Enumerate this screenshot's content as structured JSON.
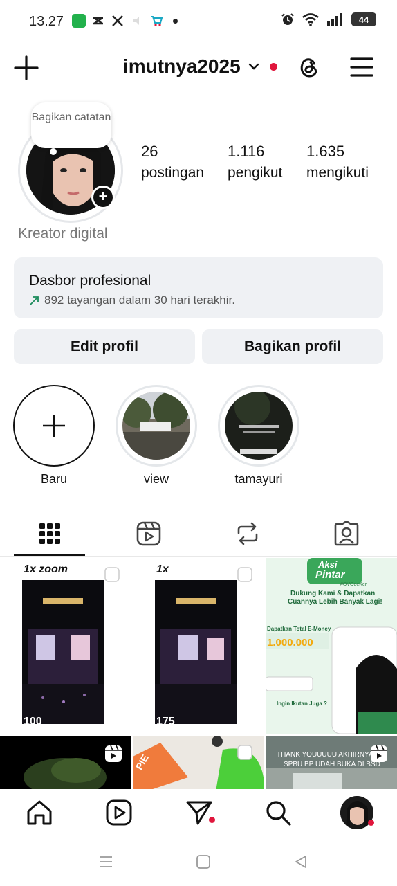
{
  "status_bar": {
    "time": "13.27",
    "battery": "44"
  },
  "header": {
    "username": "imutnya2025"
  },
  "profile": {
    "note": "Bagikan catatan",
    "stats": [
      {
        "value": "26",
        "label": "postingan"
      },
      {
        "value": "1.116",
        "label": "pengikut"
      },
      {
        "value": "1.635",
        "label": "mengikuti"
      }
    ],
    "category": "Kreator digital"
  },
  "dashboard": {
    "title": "Dasbor profesional",
    "subtitle": "892 tayangan dalam 30 hari terakhir."
  },
  "buttons": {
    "edit": "Edit profil",
    "share": "Bagikan profil"
  },
  "highlights": [
    {
      "label": "Baru"
    },
    {
      "label": "view"
    },
    {
      "label": "tamayuri"
    }
  ],
  "tabs": [
    {
      "icon": "grid-icon"
    },
    {
      "icon": "reels-icon"
    },
    {
      "icon": "repost-icon"
    },
    {
      "icon": "tagged-icon"
    }
  ],
  "grid": {
    "posts": [
      {
        "overlay": "1x zoom",
        "count": "100"
      },
      {
        "overlay": "1x",
        "count": "175"
      },
      {
        "title1": "Aksi",
        "title2": "Pintar",
        "tag": "#OVOdeKer",
        "headline": "Dukung Kami & Dapatkan",
        "headline2": "Cuannya Lebih Banyak Lagi!",
        "amount": "1.000.000",
        "prompt": "Ingin Ikutan Juga ?",
        "label": "Dapatkan Total E-Money"
      },
      {},
      {
        "brand": "PIE"
      },
      {
        "caption": "THANK YOUUUUU AKHIRNYA",
        "caption2": "SPBU BP UDAH BUKA DI BSD"
      }
    ]
  },
  "colors": {
    "accent_red": "#e0163c",
    "button_bg": "#eff1f4"
  }
}
